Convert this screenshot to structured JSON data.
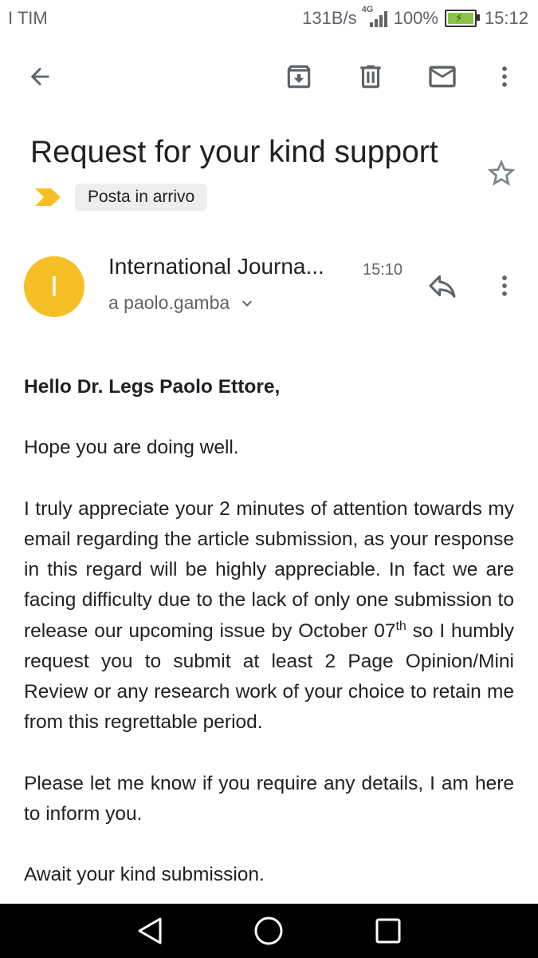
{
  "status_bar": {
    "carrier": "I TIM",
    "net_speed": "131B/s",
    "network_type": "4G",
    "battery_percent": "100%",
    "time": "15:12",
    "battery_color": "#8bc34a"
  },
  "app_bar": {
    "icons": [
      "back-arrow-icon",
      "archive-icon",
      "delete-icon",
      "mark-unread-icon",
      "more-vert-icon"
    ]
  },
  "email": {
    "subject": "Request for your kind support",
    "label": "Posta in arrivo",
    "label_marker_color": "#f6bf26",
    "sender": {
      "avatar_letter": "I",
      "avatar_color": "#f6bf26",
      "name": "International Journa...",
      "time": "15:10",
      "recipient": "a paolo.gamba"
    },
    "body": {
      "greeting": "Hello Dr. Legs Paolo Ettore,",
      "para1": "Hope you are doing well.",
      "para2_a": "I truly appreciate your 2 minutes of attention towards my email regarding the article submission, as your response in this regard will be highly appreciable. In fact we are facing difficulty due to the lack of only one submission to release our upcoming issue by October 07",
      "para2_sup": "th",
      "para2_b": " so I humbly request you to submit at least 2 Page Opinion/Mini Review or any research work of your choice to retain me from this regrettable period.",
      "para3": "Please let me know if you require any details, I am here to inform you.",
      "para4": "Await your kind submission."
    }
  },
  "nav_bar": {
    "icons": [
      "back-triangle-icon",
      "home-circle-icon",
      "recents-square-icon"
    ]
  }
}
